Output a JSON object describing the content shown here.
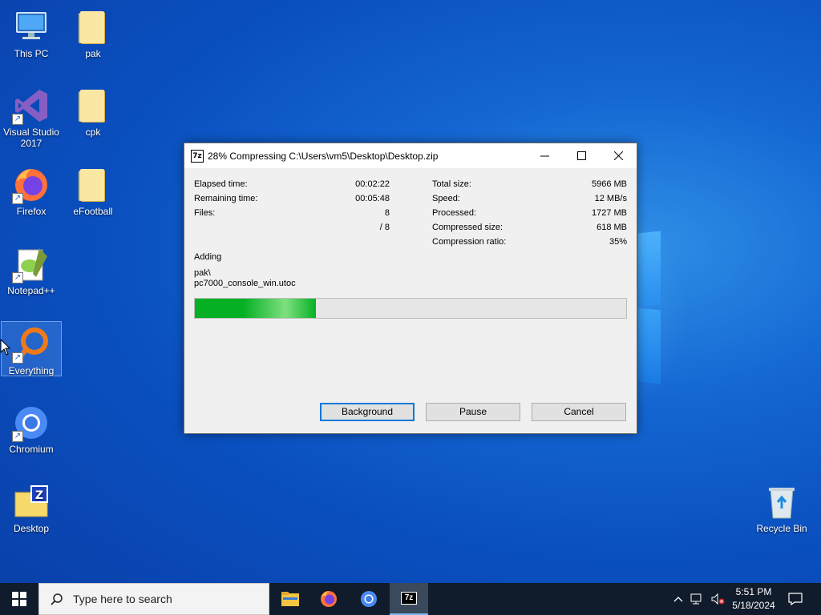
{
  "desktop": {
    "icons": [
      {
        "label": "This PC",
        "icon": "computer-icon"
      },
      {
        "label": "pak",
        "icon": "folder-icon"
      },
      {
        "label": "Visual Studio 2017",
        "icon": "visual-studio-icon"
      },
      {
        "label": "cpk",
        "icon": "folder-icon"
      },
      {
        "label": "Firefox",
        "icon": "firefox-icon"
      },
      {
        "label": "eFootball",
        "icon": "folder-icon"
      },
      {
        "label": "Notepad++",
        "icon": "notepadpp-icon"
      },
      {
        "label": "Everything",
        "icon": "everything-icon"
      },
      {
        "label": "Chromium",
        "icon": "chromium-icon"
      },
      {
        "label": "Desktop",
        "icon": "zip-folder-icon"
      },
      {
        "label": "Recycle Bin",
        "icon": "recycle-bin-icon"
      }
    ]
  },
  "dialog": {
    "app_icon_text": "7z",
    "title": "28% Compressing C:\\Users\\vm5\\Desktop\\Desktop.zip",
    "left_stats": [
      {
        "label": "Elapsed time:",
        "value": "00:02:22"
      },
      {
        "label": "Remaining time:",
        "value": "00:05:48"
      },
      {
        "label": "Files:",
        "value": "8"
      },
      {
        "label": "",
        "value": "/ 8"
      }
    ],
    "right_stats": [
      {
        "label": "Total size:",
        "value": "5966 MB"
      },
      {
        "label": "Speed:",
        "value": "12 MB/s"
      },
      {
        "label": "Processed:",
        "value": "1727 MB"
      },
      {
        "label": "Compressed size:",
        "value": "618 MB"
      },
      {
        "label": "Compression ratio:",
        "value": "35%"
      }
    ],
    "status": "Adding",
    "current_path": "pak\\",
    "current_file": "pc7000_console_win.utoc",
    "progress_fraction": 0.28,
    "buttons": {
      "background": "Background",
      "pause": "Pause",
      "cancel": "Cancel"
    }
  },
  "taskbar": {
    "search_placeholder": "Type here to search",
    "apps": [
      "file-explorer-icon",
      "firefox-icon",
      "chromium-icon",
      "7zip-icon"
    ],
    "active_app_label": "7z",
    "time": "5:51 PM",
    "date": "5/18/2024"
  },
  "colors": {
    "progress_green": "#06b025",
    "accent": "#0078d7",
    "taskbar": "#101c2b"
  }
}
